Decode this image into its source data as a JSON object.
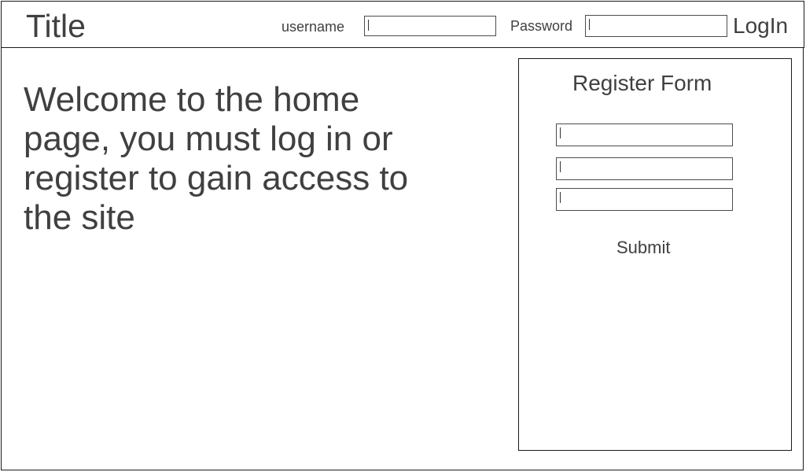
{
  "header": {
    "title": "Title",
    "username_label": "username",
    "username_value": "",
    "password_label": "Password",
    "password_value": "",
    "login_label": "LogIn"
  },
  "main": {
    "welcome_text": "Welcome to the home page, you must log in or register to gain access to the site"
  },
  "register": {
    "title": "Register Form",
    "fields": [
      {
        "value": ""
      },
      {
        "value": ""
      },
      {
        "value": ""
      }
    ],
    "submit_label": "Submit"
  }
}
